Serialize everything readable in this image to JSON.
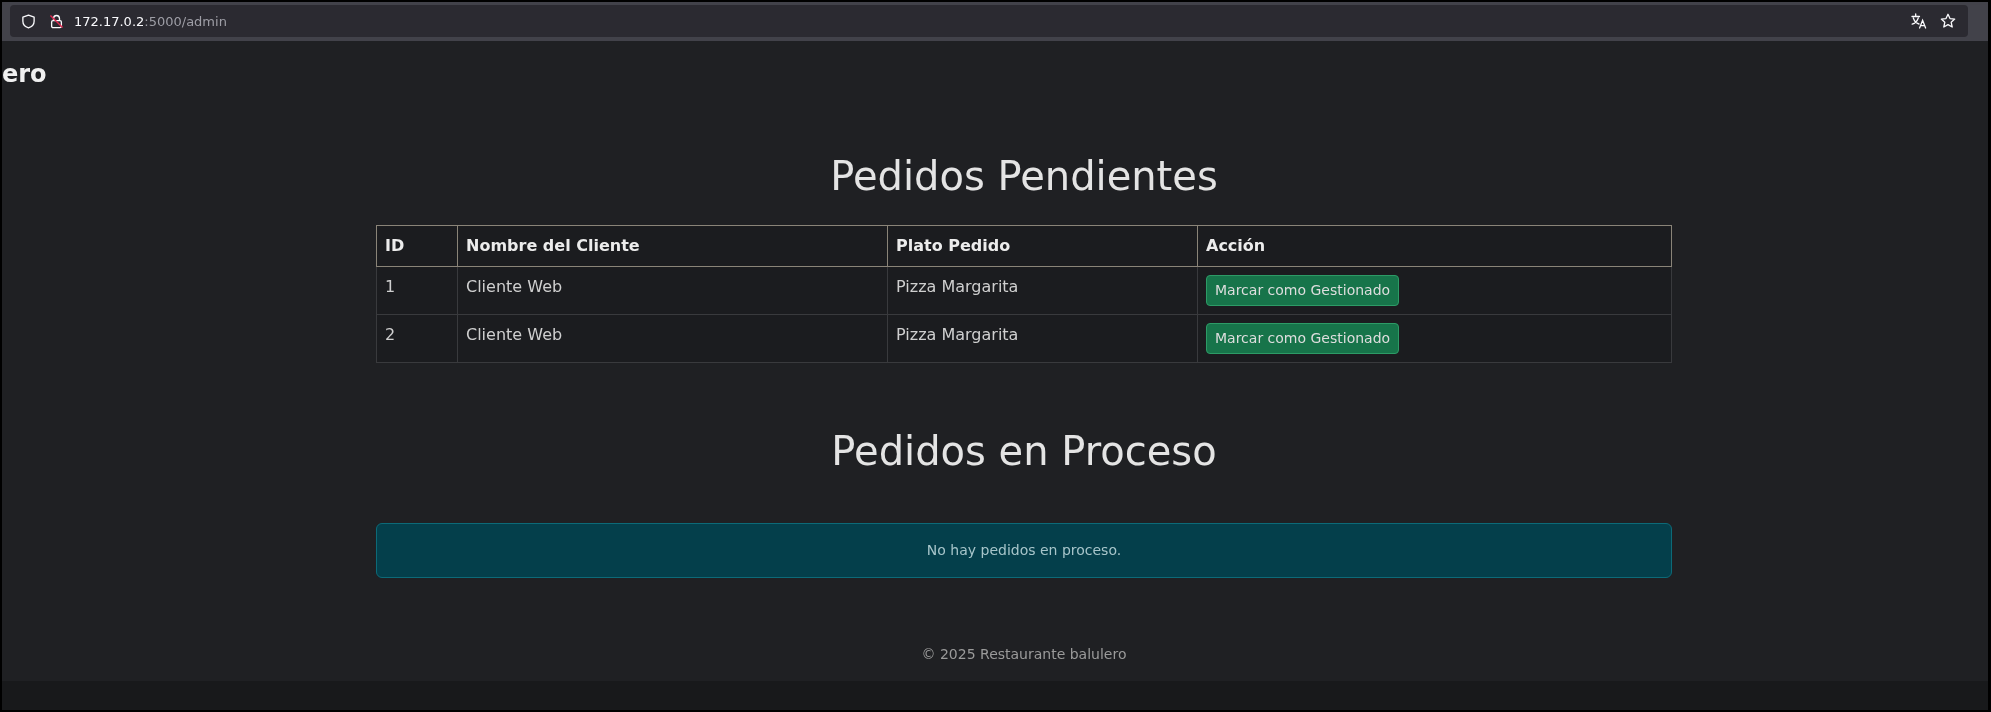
{
  "browser": {
    "url_host": "172.17.0.2",
    "url_path": ":5000/admin"
  },
  "navbar": {
    "brand": "ero"
  },
  "pending_orders": {
    "title": "Pedidos Pendientes",
    "columns": [
      "ID",
      "Nombre del Cliente",
      "Plato Pedido",
      "Acción"
    ],
    "rows": [
      {
        "id": "1",
        "client": "Cliente Web",
        "dish": "Pizza Margarita",
        "action": "Marcar como Gestionado"
      },
      {
        "id": "2",
        "client": "Cliente Web",
        "dish": "Pizza Margarita",
        "action": "Marcar como Gestionado"
      }
    ]
  },
  "orders_in_process": {
    "title": "Pedidos en Proceso",
    "alert": "No hay pedidos en proceso."
  },
  "footer": {
    "text": "© 2025 Restaurante balulero"
  }
}
